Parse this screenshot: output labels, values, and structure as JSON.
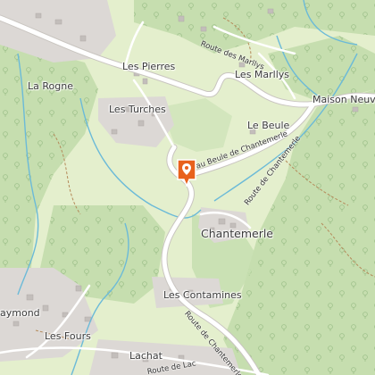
{
  "map": {
    "places": [
      {
        "id": "les-pierres",
        "label": "Les Pierres"
      },
      {
        "id": "les-marllys",
        "label": "Les Marllys"
      },
      {
        "id": "la-rogne",
        "label": "La Rogne"
      },
      {
        "id": "les-turches",
        "label": "Les Turches"
      },
      {
        "id": "maison-neuve",
        "label": "Maison Neuve"
      },
      {
        "id": "le-beule",
        "label": "Le Beule"
      },
      {
        "id": "chantemerle",
        "label": "Chantemerle"
      },
      {
        "id": "les-contamines",
        "label": "Les Contamines"
      },
      {
        "id": "aymond",
        "label": "aymond"
      },
      {
        "id": "les-fours",
        "label": "Les Fours"
      },
      {
        "id": "lachat",
        "label": "Lachat"
      }
    ],
    "roads": [
      {
        "id": "route-des-marllys",
        "label": "Route des Marllys"
      },
      {
        "id": "route-du-beule",
        "label": "au Beule de Chantemerle"
      },
      {
        "id": "route-chantemerle-e",
        "label": "Route de Chantemerle"
      },
      {
        "id": "route-chantemerle-s",
        "label": "Route de Chantemerle"
      },
      {
        "id": "route-de-lachat",
        "label": "Route de Lac"
      }
    ],
    "marker": {
      "icon": "location-pin-icon",
      "color": "#e8611c"
    },
    "colors": {
      "forest": "#c7dfb0",
      "meadow": "#e4efcd",
      "water": "#5fb8d8",
      "road": "#ffffff",
      "built": "#d9d6d4"
    }
  }
}
